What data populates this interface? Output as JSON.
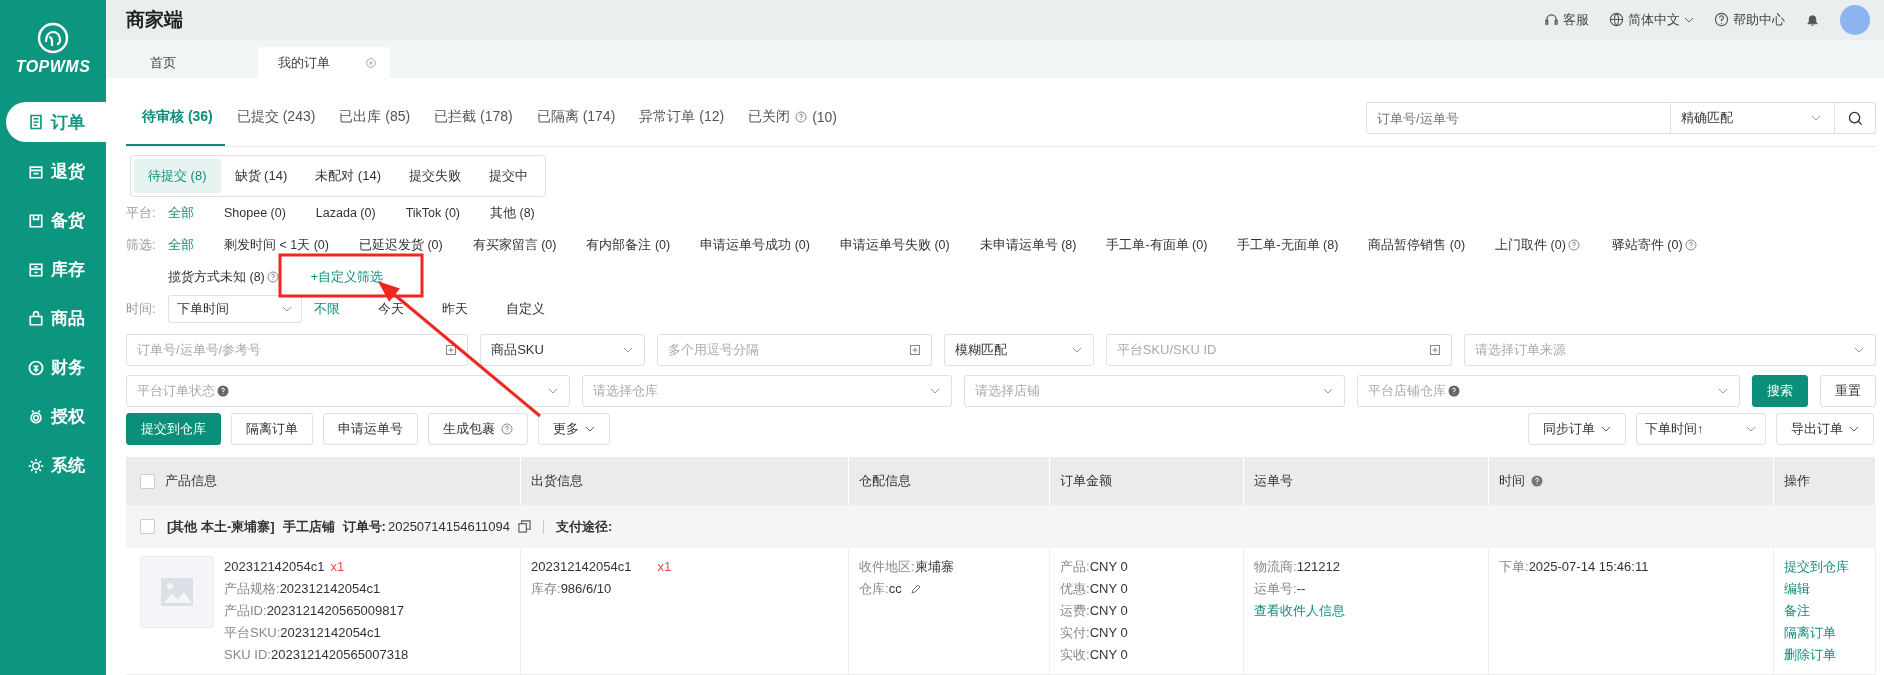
{
  "brand": {
    "name": "TOPWMS"
  },
  "sidebar": {
    "items": [
      {
        "label": "订单",
        "selected": true
      },
      {
        "label": "退货",
        "selected": false
      },
      {
        "label": "备货",
        "selected": false
      },
      {
        "label": "库存",
        "selected": false
      },
      {
        "label": "商品",
        "selected": false
      },
      {
        "label": "财务",
        "selected": false
      },
      {
        "label": "授权",
        "selected": false
      },
      {
        "label": "系统",
        "selected": false
      }
    ]
  },
  "header": {
    "title": "商家端",
    "support": "客服",
    "language": "简体中文",
    "help": "帮助中心"
  },
  "page_tabs": [
    {
      "label": "首页",
      "selected": false,
      "closable": false
    },
    {
      "label": "我的订单",
      "selected": true,
      "closable": true
    }
  ],
  "status_tabs": [
    {
      "label": "待审核 (36)",
      "selected": true,
      "help_icon": false
    },
    {
      "label": "已提交 (243)",
      "selected": false,
      "help_icon": false
    },
    {
      "label": "已出库 (85)",
      "selected": false,
      "help_icon": false
    },
    {
      "label": "已拦截 (178)",
      "selected": false,
      "help_icon": false
    },
    {
      "label": "已隔离 (174)",
      "selected": false,
      "help_icon": false
    },
    {
      "label": "异常订单 (12)",
      "selected": false,
      "help_icon": false
    },
    {
      "label": "已关闭",
      "count": "(10)",
      "selected": false,
      "help_icon": true
    }
  ],
  "quick_search": {
    "placeholder": "订单号/运单号",
    "match": "精确匹配"
  },
  "sub_tabs": [
    {
      "label": "待提交 (8)",
      "selected": true
    },
    {
      "label": "缺货 (14)",
      "selected": false
    },
    {
      "label": "未配对 (14)",
      "selected": false
    },
    {
      "label": "提交失败",
      "selected": false
    },
    {
      "label": "提交中",
      "selected": false
    }
  ],
  "platform_filter": {
    "label": "平台:",
    "options": [
      {
        "label": "全部",
        "selected": true
      },
      {
        "label": "Shopee (0)",
        "selected": false
      },
      {
        "label": "Lazada (0)",
        "selected": false
      },
      {
        "label": "TikTok (0)",
        "selected": false
      },
      {
        "label": "其他 (8)",
        "selected": false
      }
    ]
  },
  "status_filter": {
    "label": "筛选:",
    "options": [
      {
        "label": "全部",
        "selected": true,
        "help_icon": false
      },
      {
        "label": "剩发时间 < 1天 (0)",
        "selected": false,
        "help_icon": false
      },
      {
        "label": "已延迟发货 (0)",
        "selected": false,
        "help_icon": false
      },
      {
        "label": "有买家留言 (0)",
        "selected": false,
        "help_icon": false
      },
      {
        "label": "有内部备注 (0)",
        "selected": false,
        "help_icon": false
      },
      {
        "label": "申请运单号成功 (0)",
        "selected": false,
        "help_icon": false
      },
      {
        "label": "申请运单号失败 (0)",
        "selected": false,
        "help_icon": false
      },
      {
        "label": "未申请运单号 (8)",
        "selected": false,
        "help_icon": false
      },
      {
        "label": "手工单-有面单 (0)",
        "selected": false,
        "help_icon": false
      },
      {
        "label": "手工单-无面单 (8)",
        "selected": false,
        "help_icon": false
      },
      {
        "label": "商品暂停销售 (0)",
        "selected": false,
        "help_icon": false
      },
      {
        "label": "上门取件 (0)",
        "selected": false,
        "help_icon": true
      },
      {
        "label": "驿站寄件 (0)",
        "selected": false,
        "help_icon": true
      },
      {
        "label": "揽货方式未知 (8)",
        "selected": false,
        "help_icon": true
      }
    ],
    "custom": "+自定义筛选"
  },
  "time_filter": {
    "label": "时间:",
    "field": "下单时间",
    "options": [
      {
        "label": "不限",
        "selected": true
      },
      {
        "label": "今天",
        "selected": false
      },
      {
        "label": "昨天",
        "selected": false
      },
      {
        "label": "自定义",
        "selected": false
      }
    ]
  },
  "search_row_1": [
    {
      "kind": "input",
      "placeholder": "订单号/运单号/参考号"
    },
    {
      "kind": "select",
      "value": "商品SKU"
    },
    {
      "kind": "input",
      "placeholder": "多个用逗号分隔"
    },
    {
      "kind": "select",
      "value": "模糊匹配"
    },
    {
      "kind": "input",
      "placeholder": "平台SKU/SKU ID"
    },
    {
      "kind": "select",
      "placeholder": "请选择订单来源"
    }
  ],
  "search_row_2": [
    {
      "kind": "select",
      "placeholder": "平台订单状态",
      "help_icon": true
    },
    {
      "kind": "select",
      "placeholder": "请选择仓库",
      "help_icon": false
    },
    {
      "kind": "select",
      "placeholder": "请选择店铺",
      "help_icon": false
    },
    {
      "kind": "select",
      "placeholder": "平台店铺仓库",
      "help_icon": true
    }
  ],
  "search_button": "搜索",
  "reset_button": "重置",
  "actions_left": [
    {
      "label": "提交到仓库",
      "kind": "primary"
    },
    {
      "label": "隔离订单",
      "kind": "plain"
    },
    {
      "label": "申请运单号",
      "kind": "plain"
    },
    {
      "label": "生成包裹",
      "kind": "help"
    },
    {
      "label": "更多",
      "kind": "dropdown"
    }
  ],
  "actions_right": [
    {
      "label": "同步订单",
      "kind": "dropdown"
    },
    {
      "label": "下单时间↑",
      "kind": "select"
    },
    {
      "label": "导出订单",
      "kind": "dropdown"
    }
  ],
  "table": {
    "select_all": {
      "checked": false
    },
    "columns": [
      {
        "label": "产品信息",
        "help_icon": false
      },
      {
        "label": "出货信息",
        "help_icon": false
      },
      {
        "label": "仓配信息",
        "help_icon": false
      },
      {
        "label": "订单金额",
        "help_icon": false
      },
      {
        "label": "运单号",
        "help_icon": false
      },
      {
        "label": "时间",
        "help_icon": true
      },
      {
        "label": "操作",
        "help_icon": false
      }
    ],
    "groups": [
      {
        "checked": false,
        "tag": "[其他 本土-柬埔寨]",
        "shop": "手工店铺",
        "order_label": "订单号:",
        "order_no": "20250714154611094",
        "payment_label": "支付途径:",
        "rows": [
          {
            "product": {
              "name": "202312142054c1",
              "qty": "x1",
              "details": [
                {
                  "label": "产品规格:",
                  "value": "202312142054c1"
                },
                {
                  "label": "产品ID:",
                  "value": "2023121420565009817"
                },
                {
                  "label": "平台SKU:",
                  "value": "202312142054c1"
                },
                {
                  "label": "SKU ID:",
                  "value": "2023121420565007318"
                }
              ]
            },
            "shipping": {
              "name": "202312142054c1",
              "qty": "x1",
              "stock_label": "库存:",
              "stock": "986/6/10"
            },
            "warehouse": [
              {
                "kind": "text",
                "label": "收件地区:",
                "value": "柬埔寨"
              },
              {
                "kind": "editable",
                "label": "仓库:",
                "value": "cc"
              }
            ],
            "amounts": [
              {
                "label": "产品:",
                "value": "CNY 0"
              },
              {
                "label": "优惠:",
                "value": "CNY 0"
              },
              {
                "label": "运费:",
                "value": "CNY 0"
              },
              {
                "label": "实付:",
                "value": "CNY 0"
              },
              {
                "label": "实收:",
                "value": "CNY 0"
              }
            ],
            "waybill": {
              "lines": [
                {
                  "label": "物流商:",
                  "value": "121212"
                },
                {
                  "label": "运单号:",
                  "value": "--"
                }
              ],
              "link": "查看收件人信息"
            },
            "time": [
              {
                "label": "下单:",
                "value": "2025-07-14 15:46:11"
              }
            ],
            "operations": [
              "提交到仓库",
              "编辑",
              "备注",
              "隔离订单",
              "删除订单"
            ]
          }
        ]
      }
    ]
  }
}
